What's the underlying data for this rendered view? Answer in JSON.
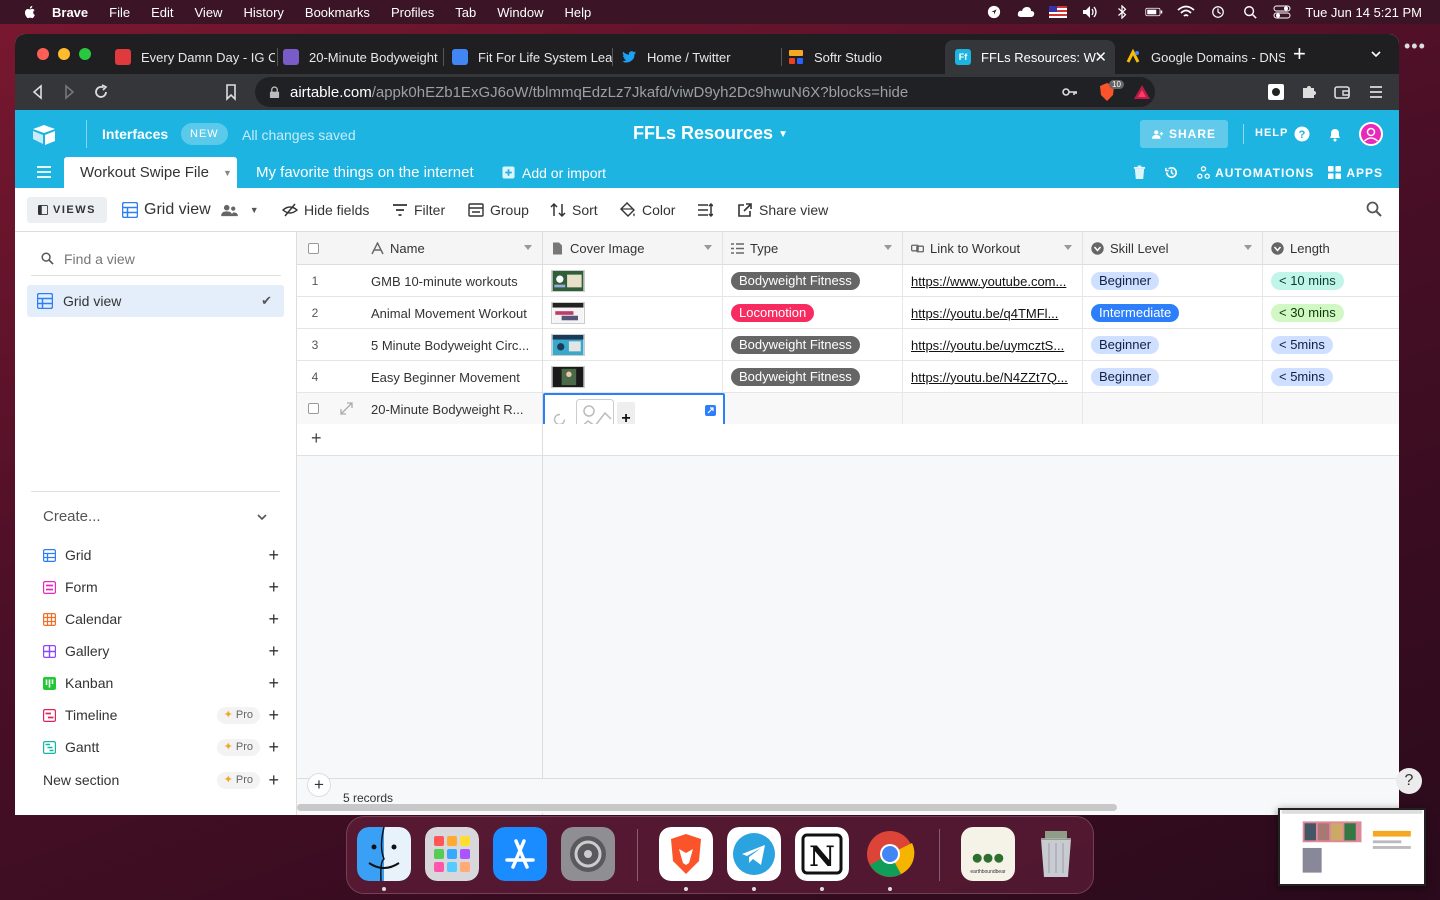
{
  "menubar": {
    "app": "Brave",
    "items": [
      "File",
      "Edit",
      "View",
      "History",
      "Bookmarks",
      "Profiles",
      "Tab",
      "Window",
      "Help"
    ],
    "datetime": "Tue Jun 14  5:21 PM"
  },
  "browser": {
    "tabs": [
      {
        "title": "Every Damn Day - IG C",
        "favicon_color": "#e03a3e"
      },
      {
        "title": "20-Minute Bodyweight",
        "favicon_color": "#7a5cc9"
      },
      {
        "title": "Fit For Life System Lea",
        "favicon_color": "#4285f4"
      },
      {
        "title": "Home / Twitter",
        "favicon_color": "#1da1f2"
      },
      {
        "title": "Softr Studio",
        "favicon_color": "#f5a623"
      },
      {
        "title": "FFLs Resources: W",
        "favicon_color": "#1db4e2",
        "active": true
      },
      {
        "title": "Google Domains - DNS",
        "favicon_color": "#fbbc05"
      }
    ],
    "url_host": "airtable.com",
    "url_path": "/appk0hEZb1ExGJ6oW/tblmmqEdzLz7Jkafd/viwD9yh2Dc9hwuN6X?blocks=hide",
    "shield_count": "10"
  },
  "header": {
    "interfaces": "Interfaces",
    "new_badge": "NEW",
    "saved_status": "All changes saved",
    "base_title": "FFLs Resources",
    "share": "SHARE",
    "help": "HELP"
  },
  "tables": {
    "active": "Workout Swipe File",
    "other": "My favorite things on the internet",
    "add_or_import": "Add or import",
    "automations": "AUTOMATIONS",
    "apps": "APPS"
  },
  "viewbar": {
    "views": "VIEWS",
    "view_name": "Grid view",
    "hide_fields": "Hide fields",
    "filter": "Filter",
    "group": "Group",
    "sort": "Sort",
    "color": "Color",
    "share_view": "Share view"
  },
  "sidebar": {
    "find_placeholder": "Find a view",
    "current_view": "Grid view",
    "create_label": "Create...",
    "create_items": [
      {
        "label": "Grid",
        "color": "#2d7ff9"
      },
      {
        "label": "Form",
        "color": "#e929ba"
      },
      {
        "label": "Calendar",
        "color": "#f36d24"
      },
      {
        "label": "Gallery",
        "color": "#8b46ff"
      },
      {
        "label": "Kanban",
        "color": "#20c933"
      },
      {
        "label": "Timeline",
        "color": "#e0245e",
        "pro": "Pro"
      },
      {
        "label": "Gantt",
        "color": "#0fb9a3",
        "pro": "Pro"
      }
    ],
    "new_section": "New section",
    "new_section_pro": "Pro"
  },
  "grid": {
    "columns": [
      "Name",
      "Cover Image",
      "Type",
      "Link to Workout",
      "Skill Level",
      "Length"
    ],
    "rows": [
      {
        "num": "1",
        "name": "GMB 10-minute workouts",
        "type": "Bodyweight Fitness",
        "type_color": "#666666",
        "link": "https://www.youtube.com...",
        "skill": "Beginner",
        "skill_color": "#cfdfff",
        "skill_text": "#102046",
        "length": "< 10 mins",
        "length_color": "#c2f5e9"
      },
      {
        "num": "2",
        "name": "Animal Movement Workout",
        "type": "Locomotion",
        "type_color": "#f82b60",
        "link": "https://youtu.be/q4TMFl...",
        "skill": "Intermediate",
        "skill_color": "#2d7ff9",
        "skill_text": "#ffffff",
        "length": "< 30 mins",
        "length_color": "#d1f7c4"
      },
      {
        "num": "3",
        "name": "5 Minute Bodyweight Circ...",
        "type": "Bodyweight Fitness",
        "type_color": "#666666",
        "link": "https://youtu.be/uymcztS...",
        "skill": "Beginner",
        "skill_color": "#cfdfff",
        "skill_text": "#102046",
        "length": "< 5mins",
        "length_color": "#cfdfff"
      },
      {
        "num": "4",
        "name": "Easy Beginner Movement",
        "type": "Bodyweight Fitness",
        "type_color": "#666666",
        "link": "https://youtu.be/N4ZZt7Q...",
        "skill": "Beginner",
        "skill_color": "#cfdfff",
        "skill_text": "#102046",
        "length": "< 5mins",
        "length_color": "#cfdfff"
      }
    ],
    "editing_row_name": "20-Minute Bodyweight R...",
    "record_count": "5 records"
  },
  "dock": {
    "apps": [
      "finder-icon",
      "launchpad-icon",
      "app-store-icon",
      "system-preferences-icon",
      "brave-icon",
      "telegram-icon",
      "notion-icon",
      "chrome-icon",
      "earthboundbear-icon",
      "trash-icon"
    ],
    "earthbound_label": "earthboundbear"
  }
}
